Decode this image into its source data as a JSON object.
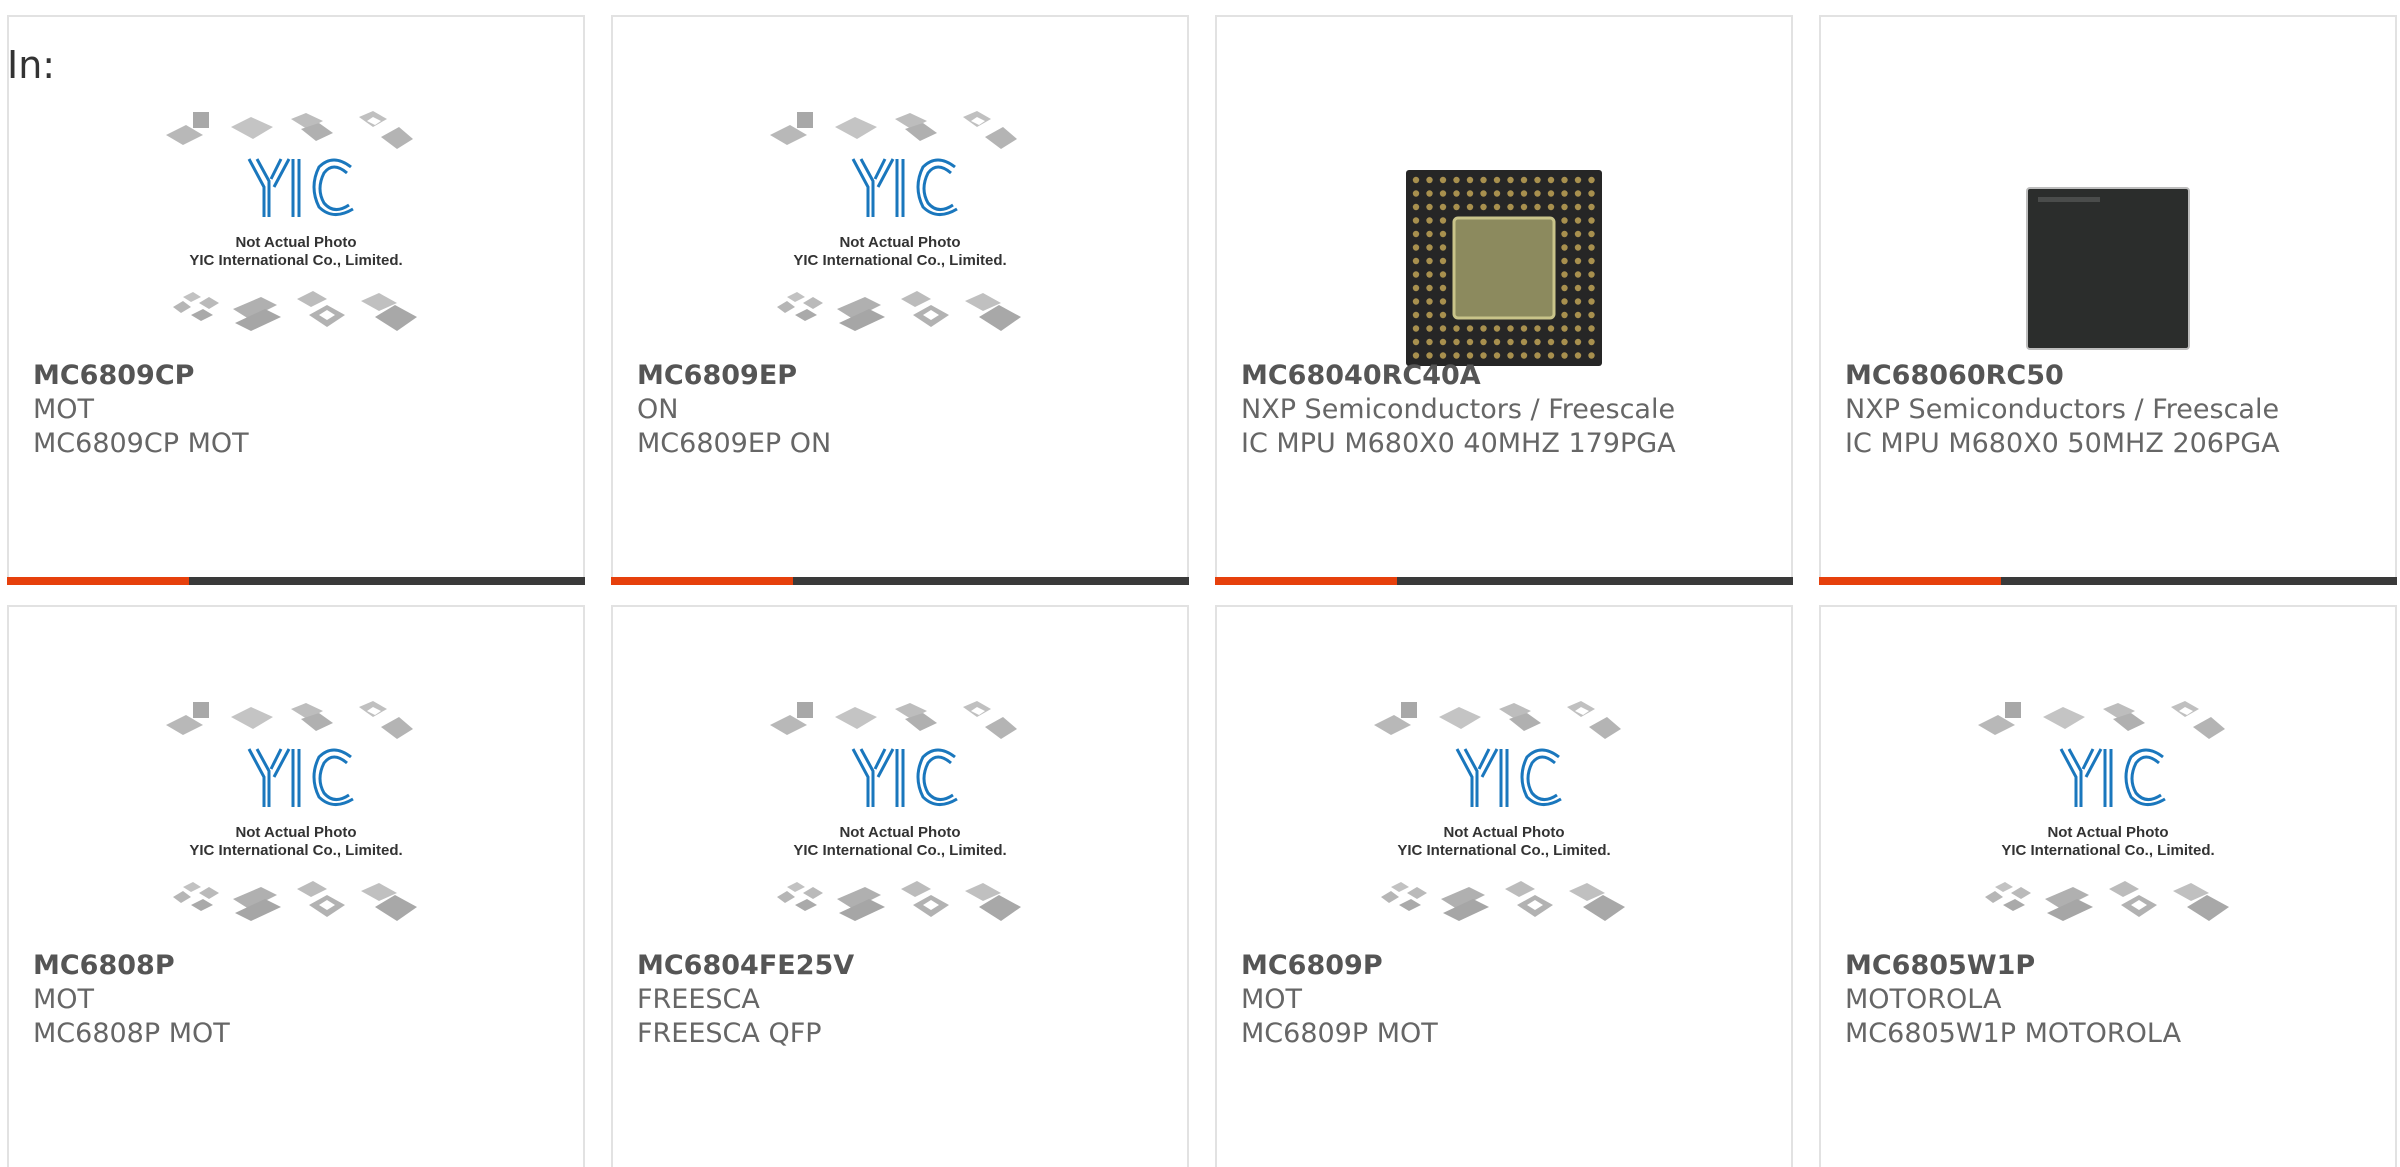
{
  "page": {
    "prefix_label": "In:"
  },
  "placeholder": {
    "line1": "Not Actual Photo",
    "line2": "YIC International Co., Limited."
  },
  "products": [
    {
      "part": "MC6809CP",
      "manufacturer": "MOT",
      "description": "MC6809CP MOT",
      "image": "placeholder"
    },
    {
      "part": "MC6809EP",
      "manufacturer": "ON",
      "description": "MC6809EP ON",
      "image": "placeholder"
    },
    {
      "part": "MC68040RC40A",
      "manufacturer": "NXP Semiconductors / Freescale",
      "description": "IC MPU M680X0 40MHZ 179PGA",
      "image": "pga-chip"
    },
    {
      "part": "MC68060RC50",
      "manufacturer": "NXP Semiconductors / Freescale",
      "description": "IC MPU M680X0 50MHZ 206PGA",
      "image": "bga-chip"
    },
    {
      "part": "MC6808P",
      "manufacturer": "MOT",
      "description": "MC6808P MOT",
      "image": "placeholder"
    },
    {
      "part": "MC6804FE25V",
      "manufacturer": "FREESCA",
      "description": "FREESCA QFP",
      "image": "placeholder"
    },
    {
      "part": "MC6809P",
      "manufacturer": "MOT",
      "description": "MC6809P MOT",
      "image": "placeholder"
    },
    {
      "part": "MC6805W1P",
      "manufacturer": "MOTOROLA",
      "description": "MC6805W1P MOTOROLA",
      "image": "placeholder"
    }
  ],
  "colors": {
    "accent": "#e6400c",
    "bar": "#3a3a3a",
    "logo_blue": "#1a77bd",
    "text": "#666666",
    "border": "#e2e2e2"
  }
}
